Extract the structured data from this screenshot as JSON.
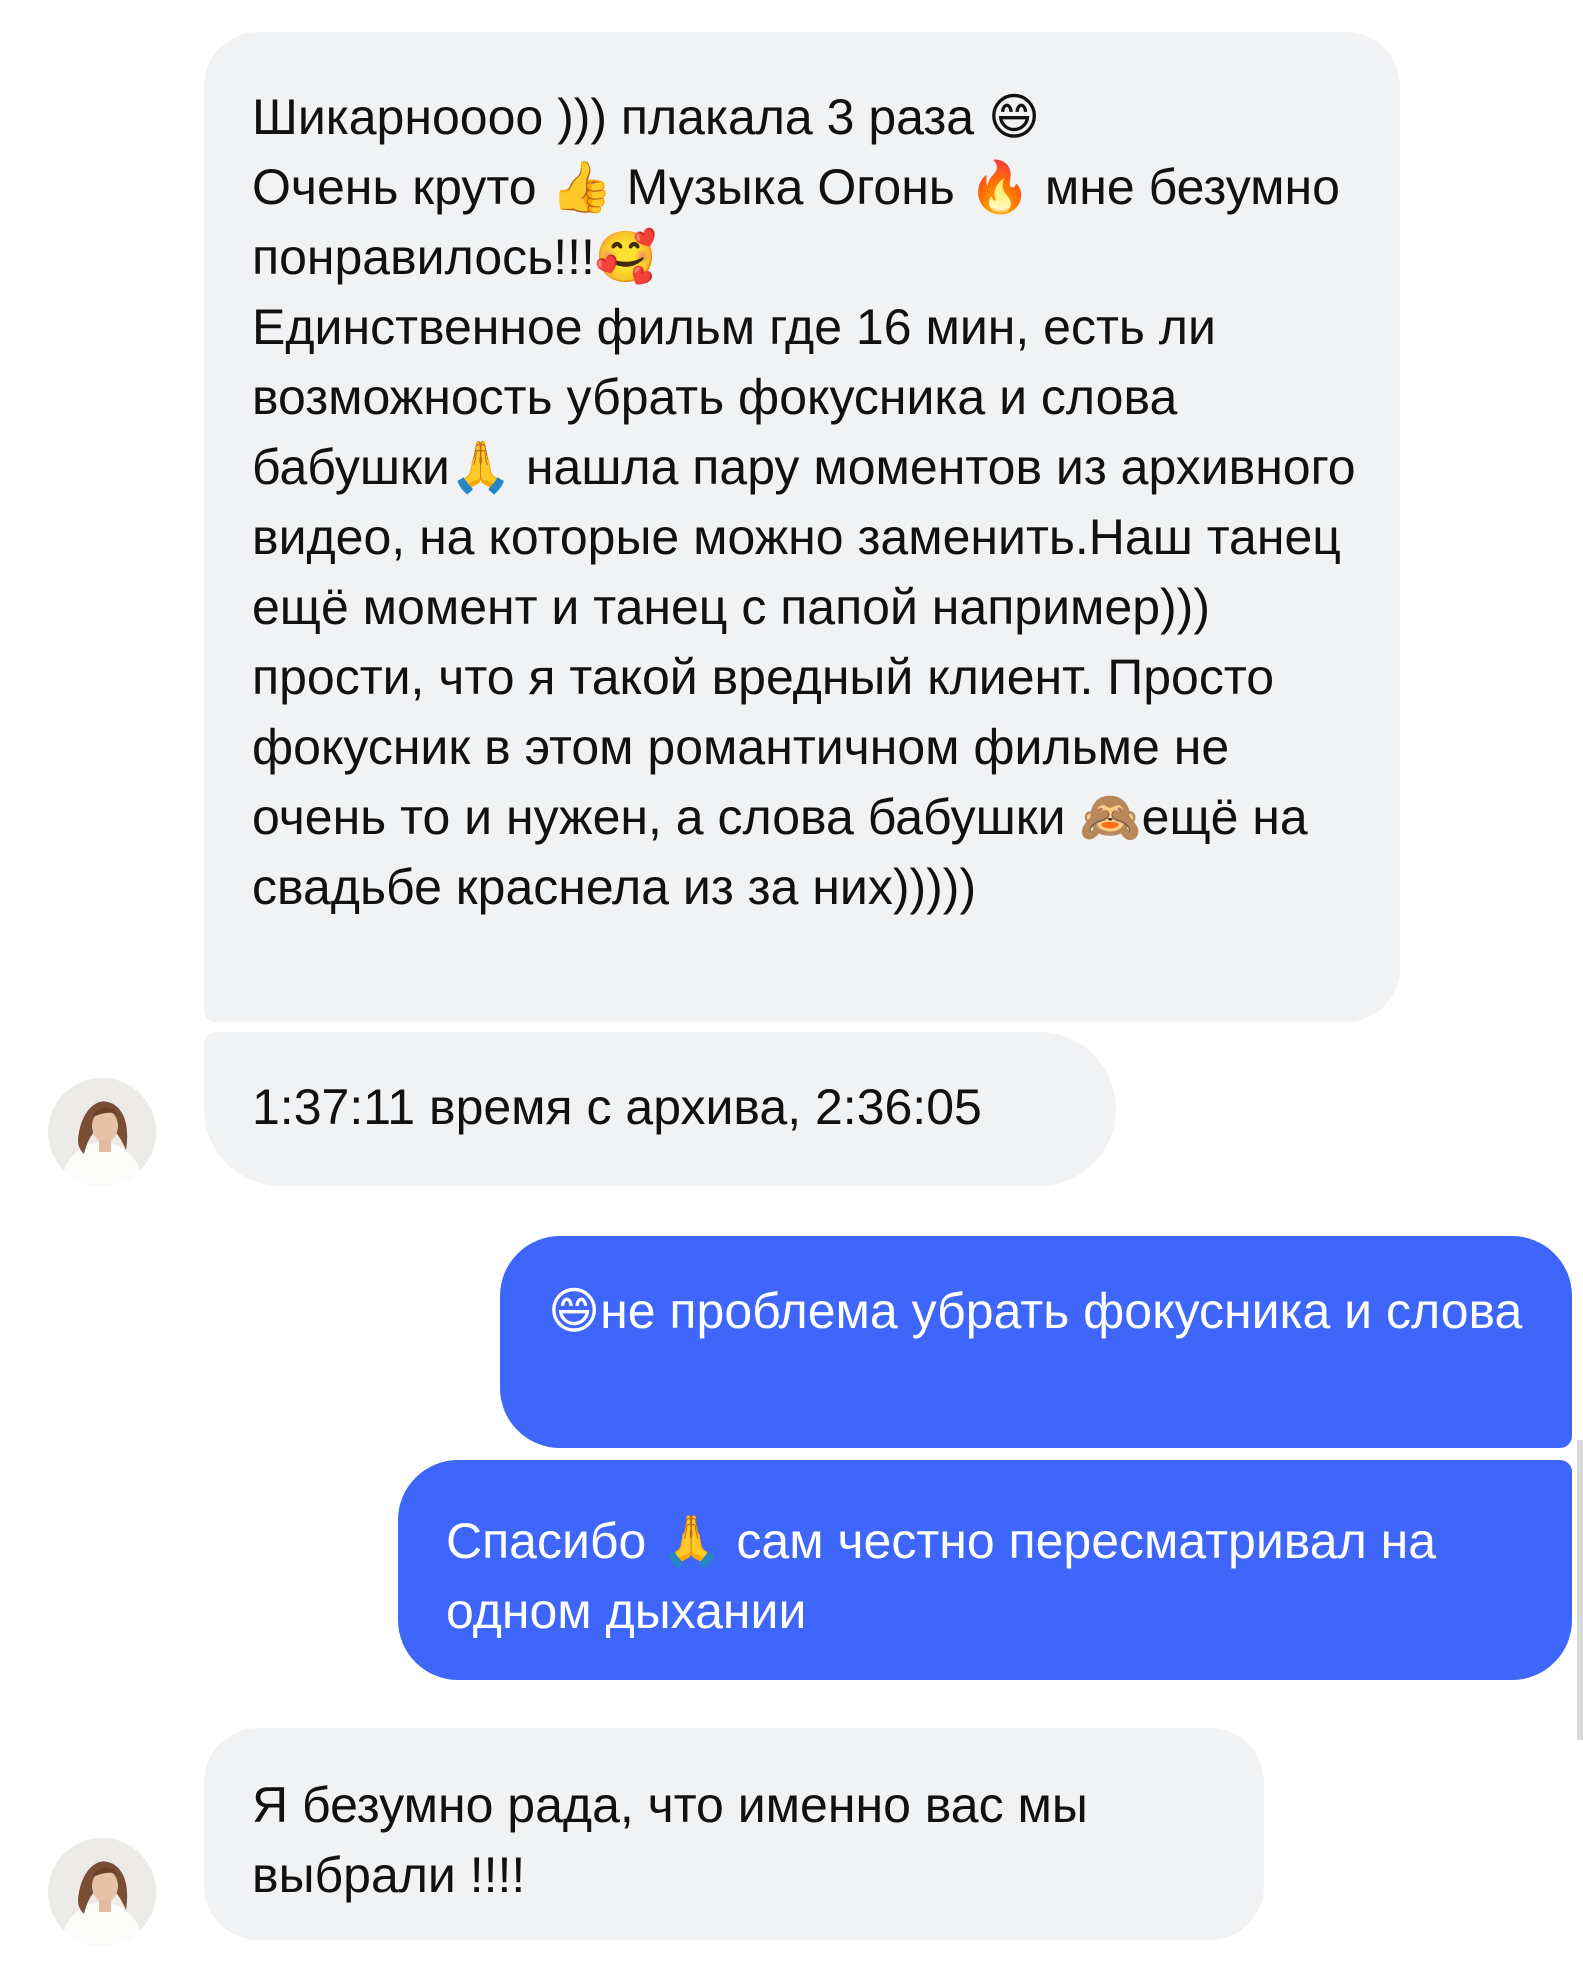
{
  "messages": [
    {
      "direction": "incoming",
      "text": "Шикарноооо ))) плакала 3 раза 😄\nОчень круто 👍 Музыка Огонь 🔥 мне безумно понравилось!!!🥰\nЕдинственное фильм где 16 мин, есть ли возможность убрать фокусника и слова бабушки🙏 нашла пару моментов из архивного видео, на которые можно заменить.Наш танец ещё момент и танец с папой например))) прости, что я такой вредный клиент. Просто фокусник в этом романтичном фильме не очень то и нужен, а слова бабушки 🙈ещё на свадьбе краснела из за них)))))"
    },
    {
      "direction": "incoming",
      "text": "1:37:11 время с архива, 2:36:05"
    },
    {
      "direction": "outgoing",
      "text": "😄не проблема убрать фокусника и слова"
    },
    {
      "direction": "outgoing",
      "text": "Спасибо 🙏 сам честно пересматривал на одном дыхании"
    },
    {
      "direction": "incoming",
      "text": "Я безумно рада, что именно вас мы выбрали !!!!"
    }
  ],
  "colors": {
    "incoming_bubble": "#f1f2f4",
    "outgoing_bubble": "#3e66fb",
    "incoming_text": "#111111",
    "outgoing_text": "#ffffff"
  }
}
